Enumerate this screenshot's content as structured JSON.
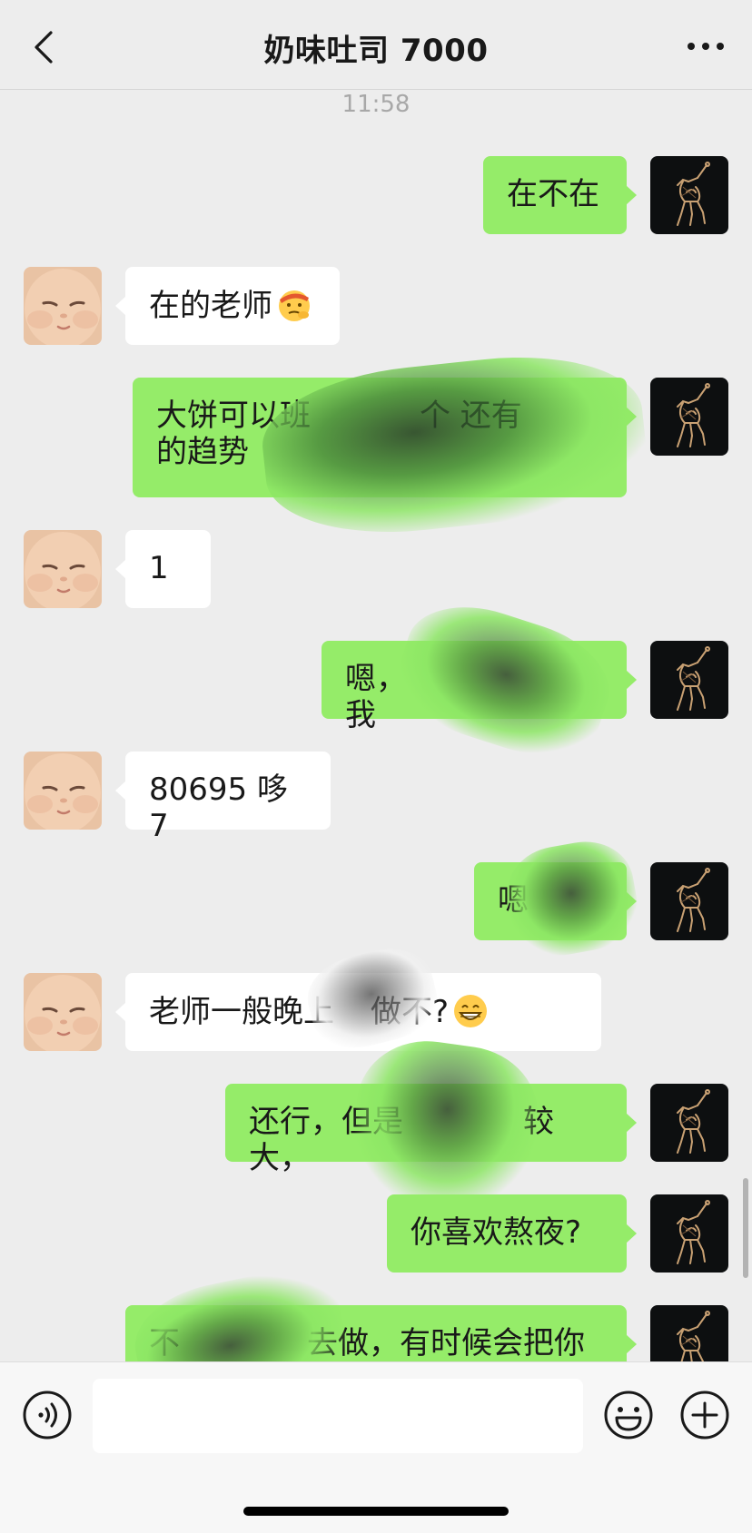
{
  "header": {
    "title": "奶味吐司 7000",
    "back_icon": "chevron-left-icon",
    "more_icon": "more-horizontal-icon"
  },
  "timestamp": "11:58",
  "messages": [
    {
      "sender": "me",
      "text": "在不在"
    },
    {
      "sender": "them",
      "text": "在的老师",
      "emoji": "saluting-face"
    },
    {
      "sender": "me",
      "line1": "大饼可以班",
      "line1b": "个 还有",
      "line2": "的趋势"
    },
    {
      "sender": "them",
      "text": "1"
    },
    {
      "sender": "me",
      "text_a": "嗯，",
      "text_b": "我"
    },
    {
      "sender": "them",
      "text": "80695 哆7"
    },
    {
      "sender": "me",
      "text": "嗯"
    },
    {
      "sender": "them",
      "text_a": "老师一般晚上",
      "text_b": "做不?",
      "emoji": "grinning-face"
    },
    {
      "sender": "me",
      "text_a": "还行，但是",
      "text_b": "较大，"
    },
    {
      "sender": "me",
      "text": "你喜欢熬夜?"
    },
    {
      "sender": "me",
      "text_a": "不",
      "text_b": "去做，有时候会把你"
    }
  ],
  "input_bar": {
    "voice_icon": "voice-icon",
    "emoji_icon": "smiley-icon",
    "plus_icon": "plus-circle-icon",
    "input_value": ""
  },
  "colors": {
    "background": "#ededed",
    "my_bubble": "#95ec69",
    "their_bubble": "#ffffff"
  }
}
